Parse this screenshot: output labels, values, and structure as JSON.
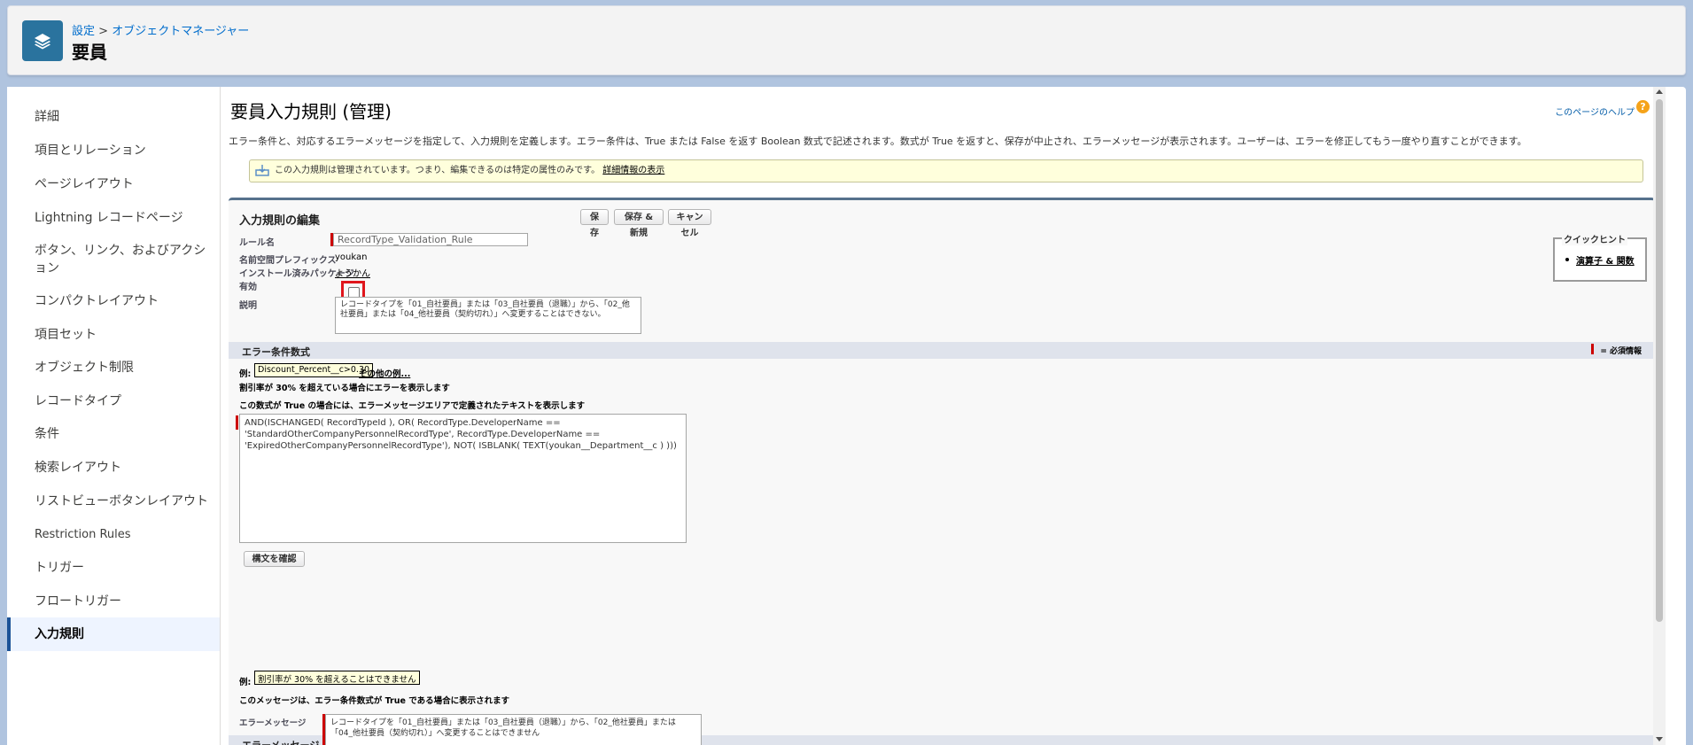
{
  "header": {
    "breadcrumb_root": "設定",
    "breadcrumb_sep": " > ",
    "breadcrumb_child": "オブジェクトマネージャー",
    "title": "要員"
  },
  "sidebar": {
    "items": [
      {
        "label": "詳細"
      },
      {
        "label": "項目とリレーション"
      },
      {
        "label": "ページレイアウト"
      },
      {
        "label": "Lightning レコードページ"
      },
      {
        "label": "ボタン、リンク、およびアクション"
      },
      {
        "label": "コンパクトレイアウト"
      },
      {
        "label": "項目セット"
      },
      {
        "label": "オブジェクト制限"
      },
      {
        "label": "レコードタイプ"
      },
      {
        "label": "条件"
      },
      {
        "label": "検索レイアウト"
      },
      {
        "label": "リストビューボタンレイアウト"
      },
      {
        "label": "Restriction Rules"
      },
      {
        "label": "トリガー"
      },
      {
        "label": "フロートリガー"
      },
      {
        "label": "入力規則"
      }
    ],
    "active": "入力規則"
  },
  "page": {
    "title": "要員入力規則 (管理)",
    "help_link": "このページのヘルプ",
    "description": "エラー条件と、対応するエラーメッセージを指定して、入力規則を定義します。エラー条件は、True または False を返す Boolean 数式で記述されます。数式が True を返すと、保存が中止され、エラーメッセージが表示されます。ユーザーは、エラーを修正してもう一度やり直すことができます。",
    "notice_text": "この入力規則は管理されています。つまり、編集できるのは特定の属性のみです。",
    "notice_link": "詳細情報の表示"
  },
  "edit": {
    "block_title": "入力規則の編集",
    "save": "保存",
    "save_new": "保存 & 新規",
    "cancel": "キャンセル",
    "rule_name_label": "ルール名",
    "rule_name_value": "RecordType_Validation_Rule",
    "namespace_label": "名前空間プレフィックス",
    "namespace_value": "youkan",
    "package_label": "インストール済みパッケージ",
    "package_value": "ようかん",
    "active_label": "有効",
    "active_checked": false,
    "desc_label": "説明",
    "desc_value": "レコードタイプを「01_自社要員」または「03_自社要員（退職）」から、「02_他社要員」または「04_他社要員（契約切れ）」へ変更することはできない。"
  },
  "quick_hints": {
    "title": "クイックヒント",
    "link": "演算子 & 関数"
  },
  "formula": {
    "section_title": "エラー条件数式",
    "required_legend": "= 必須情報",
    "example_label": "例:",
    "example_value": "Discount_Percent__c>0.30",
    "more_examples": "その他の例...",
    "example_desc": "割引率が 30% を超えている場合にエラーを表示します",
    "hint_pre": "この数式が ",
    "hint_bold": "True",
    "hint_post": " の場合には、エラーメッセージエリアで定義されたテキストを表示します",
    "formula_text": "AND(ISCHANGED( RecordTypeId ), OR( RecordType.DeveloperName ==\n'StandardOtherCompanyPersonnelRecordType', RecordType.DeveloperName ==\n'ExpiredOtherCompanyPersonnelRecordType'), NOT( ISBLANK( TEXT(youkan__Department__c ) )))",
    "check_syntax": "構文を確認"
  },
  "error_message": {
    "section_title": "エラーメッセージ",
    "example_label": "例:",
    "example_value": "割引率が 30% を超えることはできません",
    "hint_pre": "このメッセージは、エラー条件数式が ",
    "hint_bold": "True",
    "hint_post": " である場合に表示されます",
    "field_label": "エラーメッセージ",
    "field_value": "レコードタイプを「01_自社要員」または「03_自社要員（退職）」から、「02_他社要員」または「04_他社要員（契約切れ）」へ変更することはできません"
  }
}
